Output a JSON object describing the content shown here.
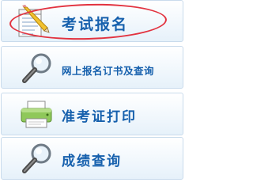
{
  "menu": {
    "items": [
      {
        "label": "考试报名",
        "icon": "registration-form-icon",
        "highlighted": true
      },
      {
        "label": "网上报名订书及查询",
        "icon": "magnifier-icon",
        "highlighted": false
      },
      {
        "label": "准考证打印",
        "icon": "printer-icon",
        "highlighted": false
      },
      {
        "label": "成绩查询",
        "icon": "magnifier-icon",
        "highlighted": false
      }
    ]
  },
  "colors": {
    "label": "#1660ad",
    "highlight_ring": "#e2323f",
    "item_border": "#c9dbec",
    "item_background": "#eef6fc"
  }
}
